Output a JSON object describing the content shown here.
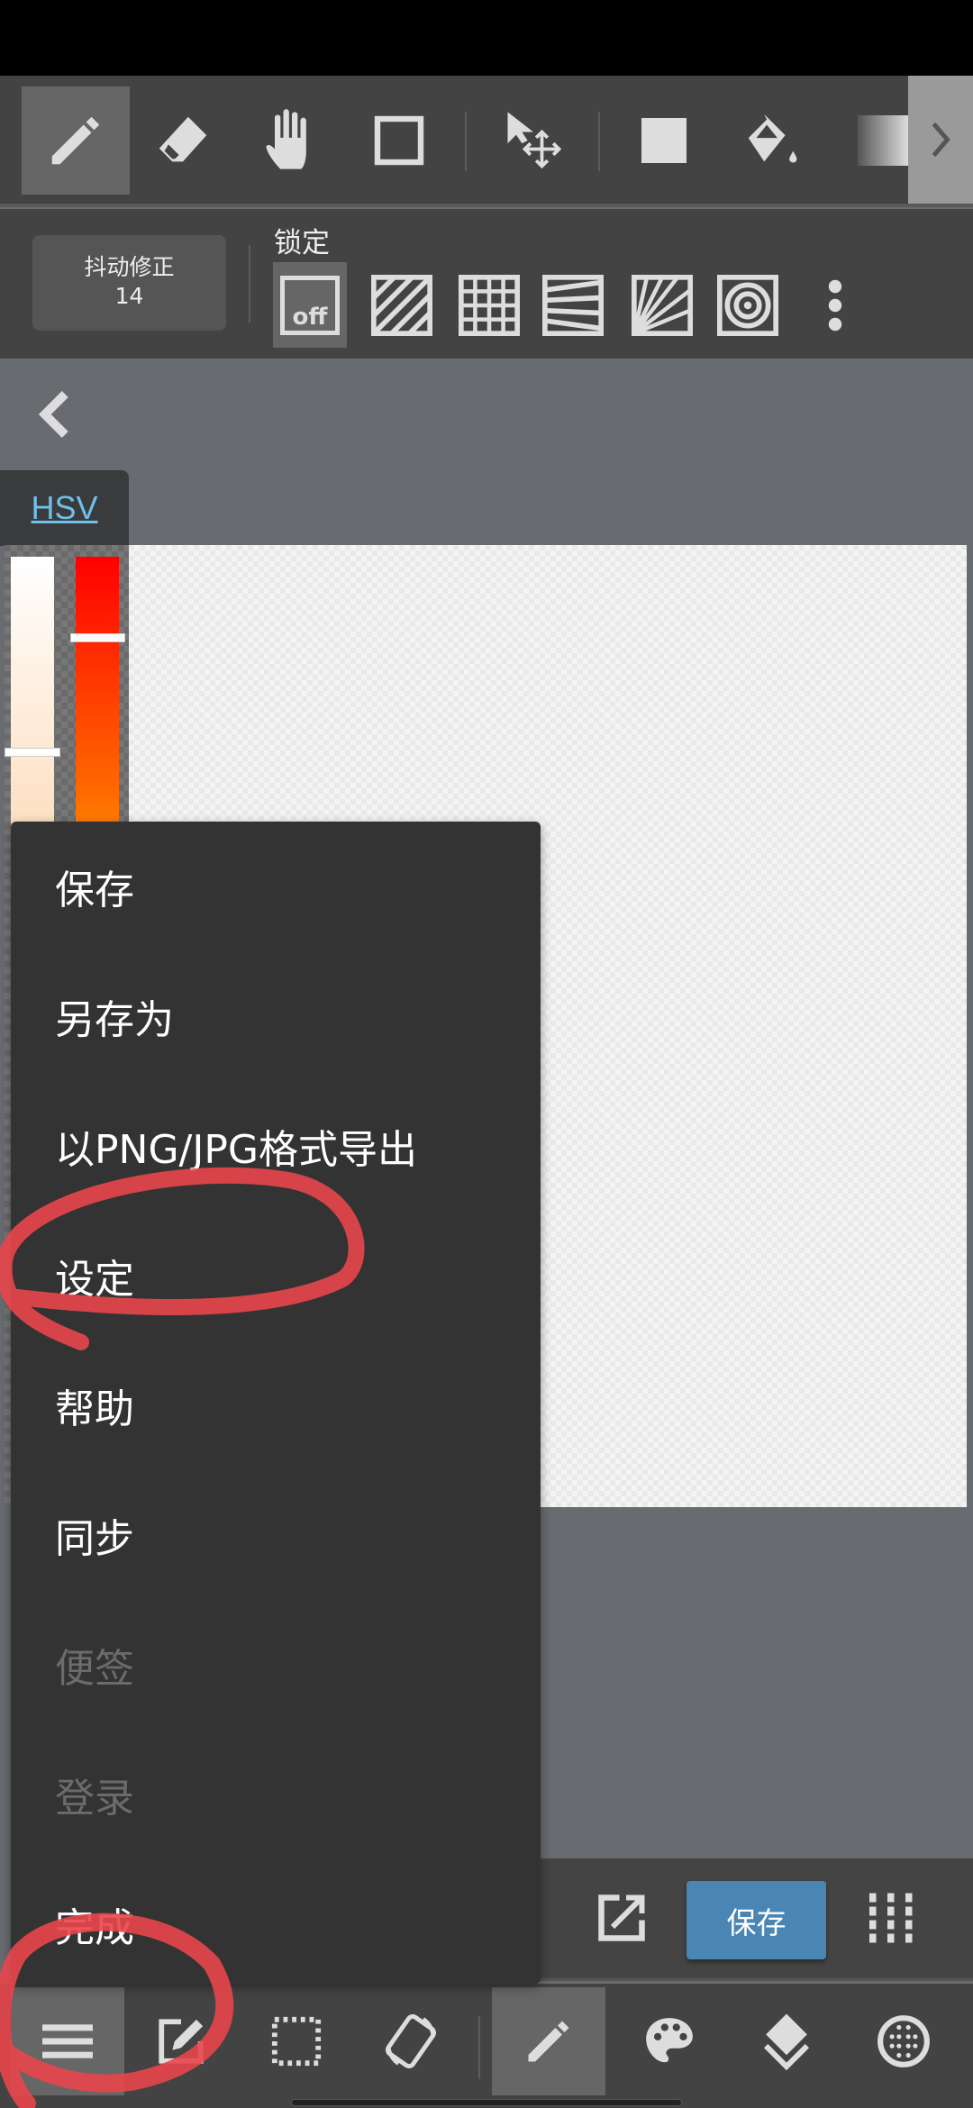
{
  "toolbar": {
    "tools": [
      "pencil-icon",
      "eraser-icon",
      "hand-icon",
      "rectangle-icon",
      "select-move-icon",
      "fill-square-icon",
      "bucket-icon",
      "gradient-icon"
    ],
    "selected_tool": "pencil-icon",
    "more_icon": "chevron-right-icon"
  },
  "stabilizer": {
    "label": "抖动修正",
    "value": "14"
  },
  "lock": {
    "label": "锁定",
    "off_label": "off",
    "options": [
      "off",
      "parallel",
      "grid",
      "perspective-horizontal",
      "radial",
      "concentric"
    ],
    "selected": "off"
  },
  "color_panel": {
    "tab_label": "HSV",
    "tab_color": "#6ec0ea",
    "saturation_level": 0.17,
    "hue_level": 0.06
  },
  "menu": {
    "items": [
      {
        "label": "保存",
        "enabled": true
      },
      {
        "label": "另存为",
        "enabled": true
      },
      {
        "label": "以PNG/JPG格式导出",
        "enabled": true
      },
      {
        "label": "设定",
        "enabled": true
      },
      {
        "label": "帮助",
        "enabled": true
      },
      {
        "label": "同步",
        "enabled": true
      },
      {
        "label": "便签",
        "enabled": false
      },
      {
        "label": "登录",
        "enabled": false
      },
      {
        "label": "完成",
        "enabled": true
      }
    ]
  },
  "action_bar": {
    "save_label": "保存",
    "save_color": "#4a86b4"
  },
  "bottom_nav": {
    "items": [
      "menu-icon",
      "edit-icon",
      "selection-icon",
      "rotate-icon",
      "pencil-icon",
      "palette-icon",
      "layers-icon",
      "material-icon"
    ],
    "selected": [
      "menu-icon",
      "pencil-icon"
    ]
  },
  "annotation_color": "#e8464b"
}
